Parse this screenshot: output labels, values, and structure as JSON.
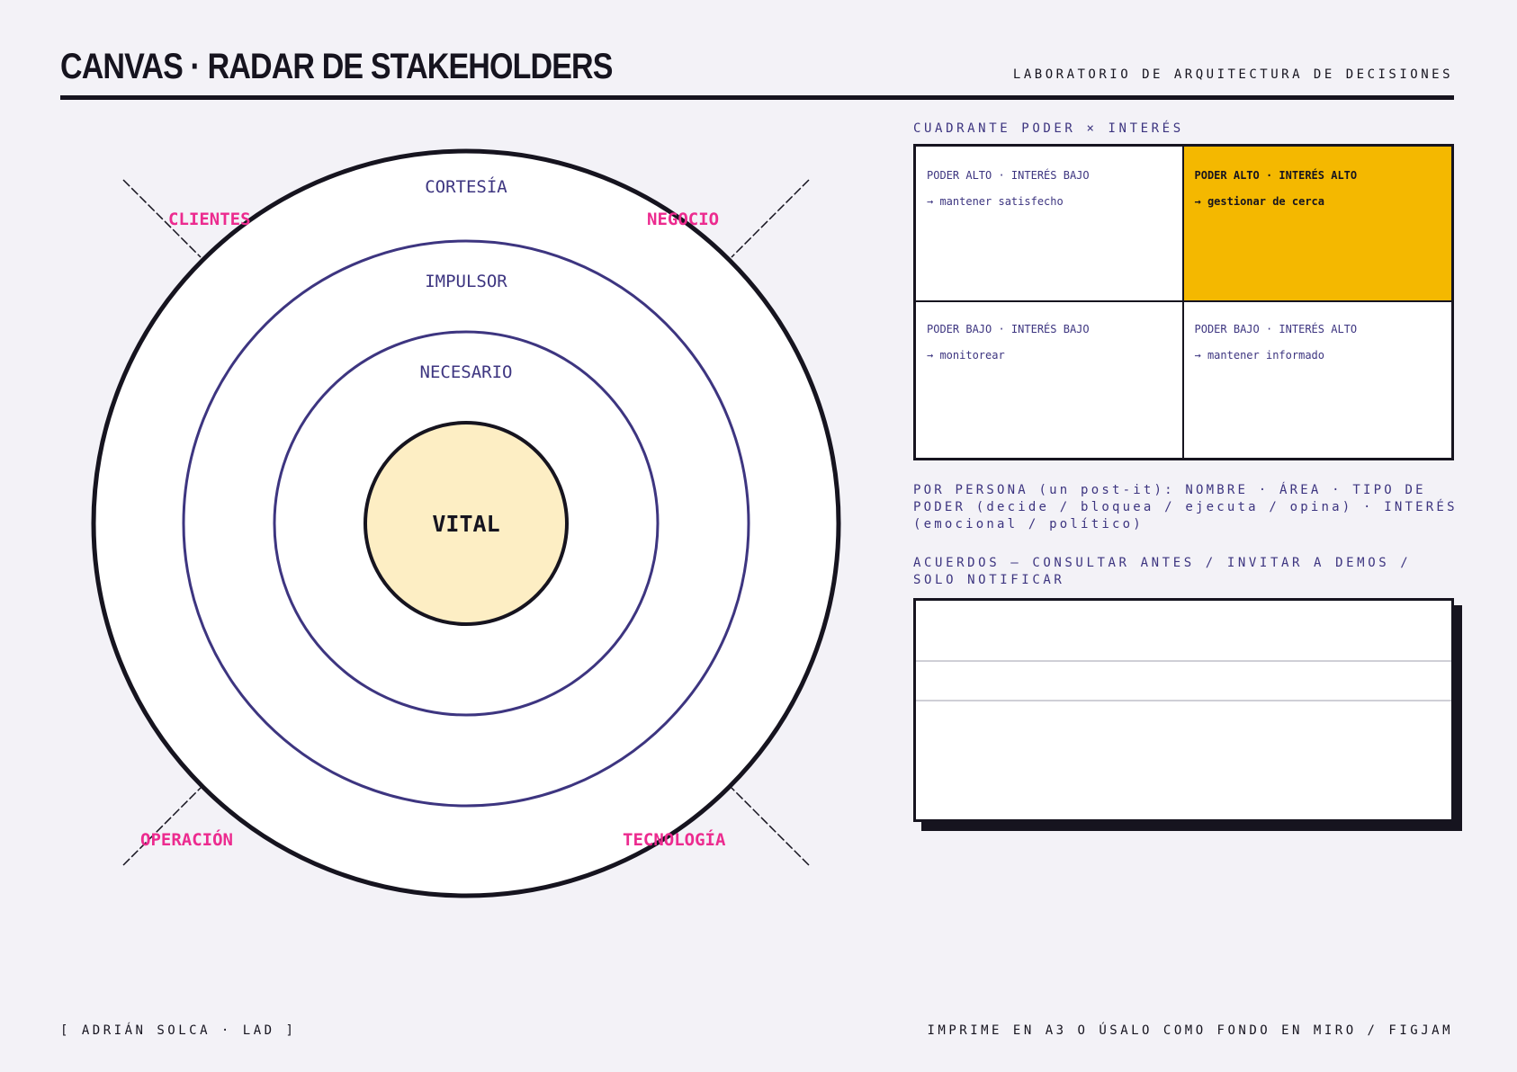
{
  "header": {
    "title": "CANVAS · RADAR DE STAKEHOLDERS",
    "subtitle": "LABORATORIO DE ARQUITECTURA DE DECISIONES"
  },
  "radar": {
    "rings": [
      "CORTESÍA",
      "IMPULSOR",
      "NECESARIO"
    ],
    "center": "VITAL",
    "sectors": [
      "CLIENTES",
      "NEGOCIO",
      "OPERACIÓN",
      "TECNOLOGÍA"
    ]
  },
  "quadrant": {
    "title": "CUADRANTE PODER × INTERÉS",
    "cells": [
      {
        "head": "PODER ALTO · INTERÉS BAJO",
        "action": "→ mantener satisfecho"
      },
      {
        "head": "PODER ALTO · INTERÉS ALTO",
        "action": "→ gestionar de cerca"
      },
      {
        "head": "PODER BAJO · INTERÉS BAJO",
        "action": "→ monitorear"
      },
      {
        "head": "PODER BAJO · INTERÉS ALTO",
        "action": "→ mantener informado"
      }
    ],
    "highlight_color": "#f4b800"
  },
  "persona": {
    "text": "POR PERSONA (un post-it): NOMBRE · ÁREA · TIPO DE PODER (decide / bloquea / ejecuta / opina) · INTERÉS (emocional / político)"
  },
  "agreements": {
    "title": "ACUERDOS — CONSULTAR ANTES / INVITAR A DEMOS / SOLO NOTIFICAR"
  },
  "footer": {
    "left": "[ ADRIÁN SOLCA · LAD ]",
    "right": "IMPRIME EN A3 O ÚSALO COMO FONDO EN MIRO / FIGJAM"
  },
  "colors": {
    "ink": "#16141f",
    "ring": "#3d3580",
    "sector": "#ec2b8f",
    "vital_fill": "#fdeec4",
    "background": "#f3f2f7"
  }
}
